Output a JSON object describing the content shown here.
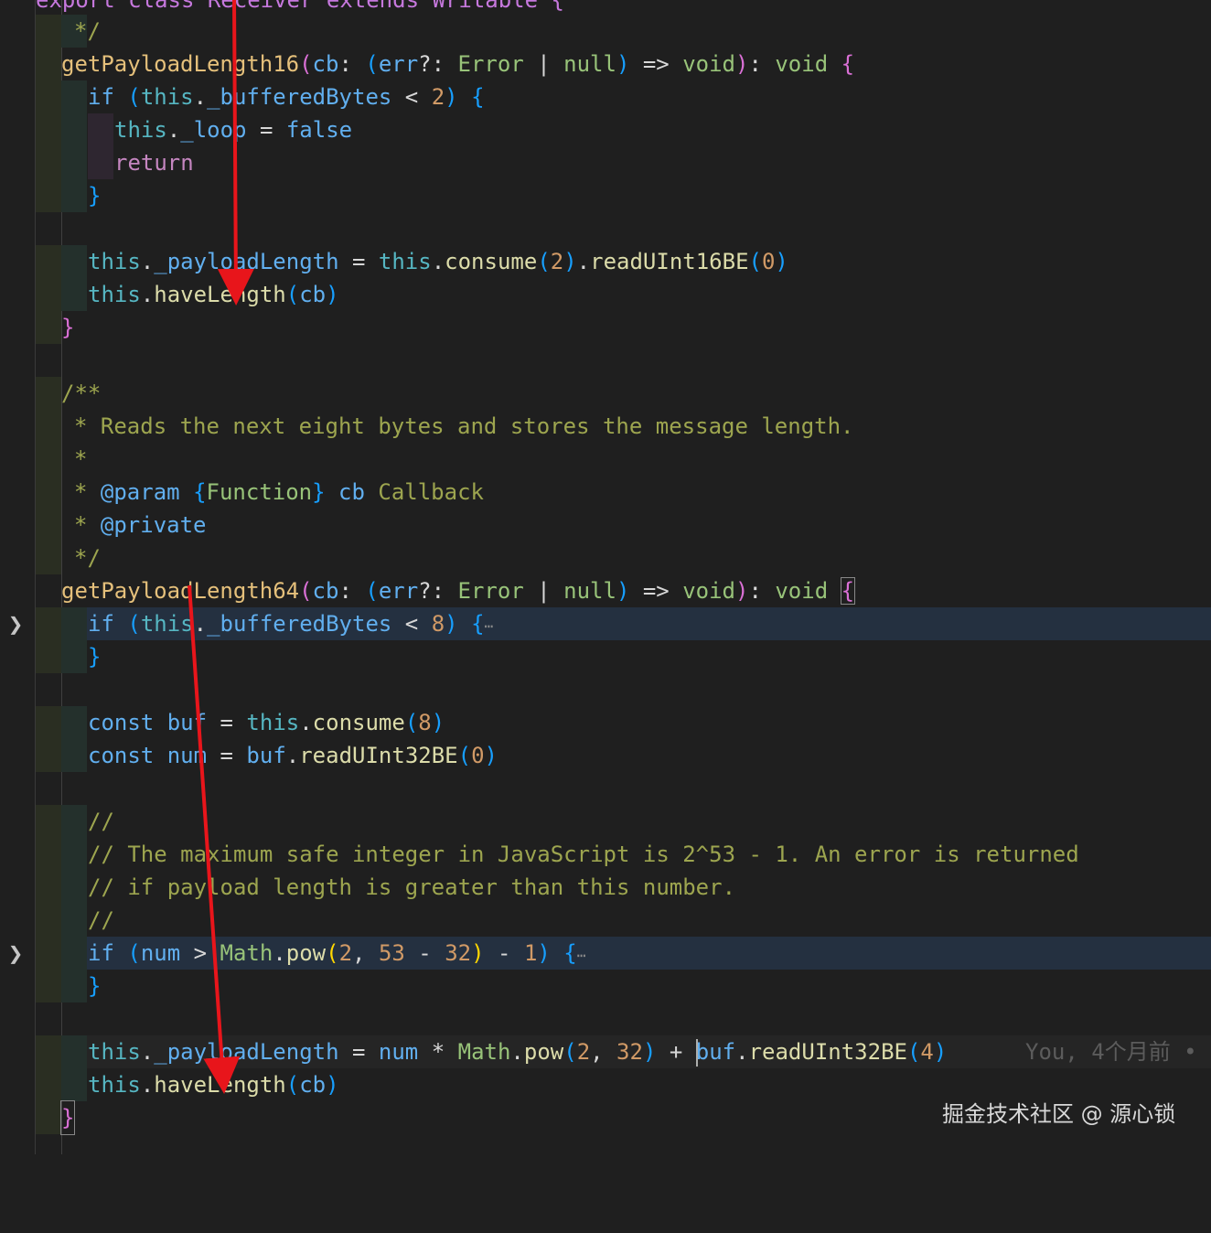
{
  "editor": {
    "lines": [
      {
        "text": "export class Receiver extends Writable {",
        "kind": "top"
      },
      {
        "text": "*/"
      },
      {
        "text": "getPayloadLength16(cb: (err?: Error | null) => void): void {"
      },
      {
        "text": "if (this._bufferedBytes < 2) {"
      },
      {
        "text": "this._loop = false"
      },
      {
        "text": "return"
      },
      {
        "text": "}"
      },
      {
        "text": ""
      },
      {
        "text": "this._payloadLength = this.consume(2).readUInt16BE(0)"
      },
      {
        "text": "this.haveLength(cb)"
      },
      {
        "text": "}"
      },
      {
        "text": ""
      },
      {
        "text": "/**"
      },
      {
        "text": "* Reads the next eight bytes and stores the message length."
      },
      {
        "text": "*"
      },
      {
        "text": "* @param {Function} cb Callback"
      },
      {
        "text": "* @private"
      },
      {
        "text": "*/"
      },
      {
        "text": "getPayloadLength64(cb: (err?: Error | null) => void): void {"
      },
      {
        "text": "if (this._bufferedBytes < 8) {"
      },
      {
        "text": "}"
      },
      {
        "text": ""
      },
      {
        "text": "const buf = this.consume(8)"
      },
      {
        "text": "const num = buf.readUInt32BE(0)"
      },
      {
        "text": ""
      },
      {
        "text": "//"
      },
      {
        "text": "// The maximum safe integer in JavaScript is 2^53 - 1. An error is returned"
      },
      {
        "text": "// if payload length is greater than this number."
      },
      {
        "text": "//"
      },
      {
        "text": "if (num > Math.pow(2, 53 - 32) - 1) {"
      },
      {
        "text": "}"
      },
      {
        "text": ""
      },
      {
        "text": "this._payloadLength = num * Math.pow(2, 32) + buf.readUInt32BE(4)"
      },
      {
        "text": "this.haveLength(cb)"
      },
      {
        "text": "}"
      }
    ],
    "blame": "You, 4个月前 •",
    "fold_icon": "chevron-right-icon",
    "ellipsis": "⋯"
  },
  "watermark": "掘金技术社区 @ 源心锁",
  "colors": {
    "arrow": "#e8151b",
    "background": "#1f1f1f"
  }
}
